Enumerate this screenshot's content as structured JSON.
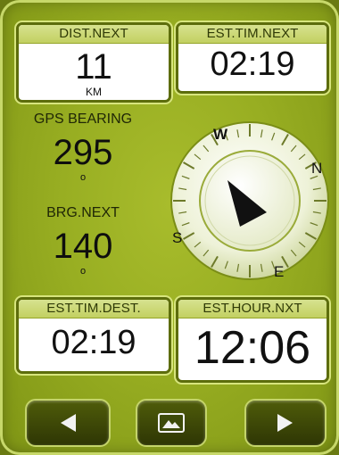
{
  "fields": {
    "dist_next": {
      "label": "DIST.NEXT",
      "value": "11",
      "unit": "KM"
    },
    "est_tim_next": {
      "label": "EST.TIM.NEXT",
      "value": "02:19"
    },
    "est_tim_dest": {
      "label": "EST.TIM.DEST.",
      "value": "02:19"
    },
    "est_hour_nxt": {
      "label": "EST.HOUR.NXT",
      "value": "12:06"
    }
  },
  "bearings": {
    "gps_bearing": {
      "label": "GPS BEARING",
      "value": "295",
      "unit": "o"
    },
    "brg_next": {
      "label": "BRG.NEXT",
      "value": "140",
      "unit": "o"
    }
  },
  "compass": {
    "labels": {
      "west": "W",
      "north": "N",
      "south": "S",
      "east": "E"
    },
    "heading_deg": 295,
    "pointer_color": "#111111"
  },
  "buttons": {
    "prev": "left-arrow-icon",
    "map": "map-icon",
    "next": "right-arrow-icon"
  },
  "colors": {
    "background": "#98ae22",
    "label_bar": "#c2d061",
    "button": "#3c4706"
  }
}
